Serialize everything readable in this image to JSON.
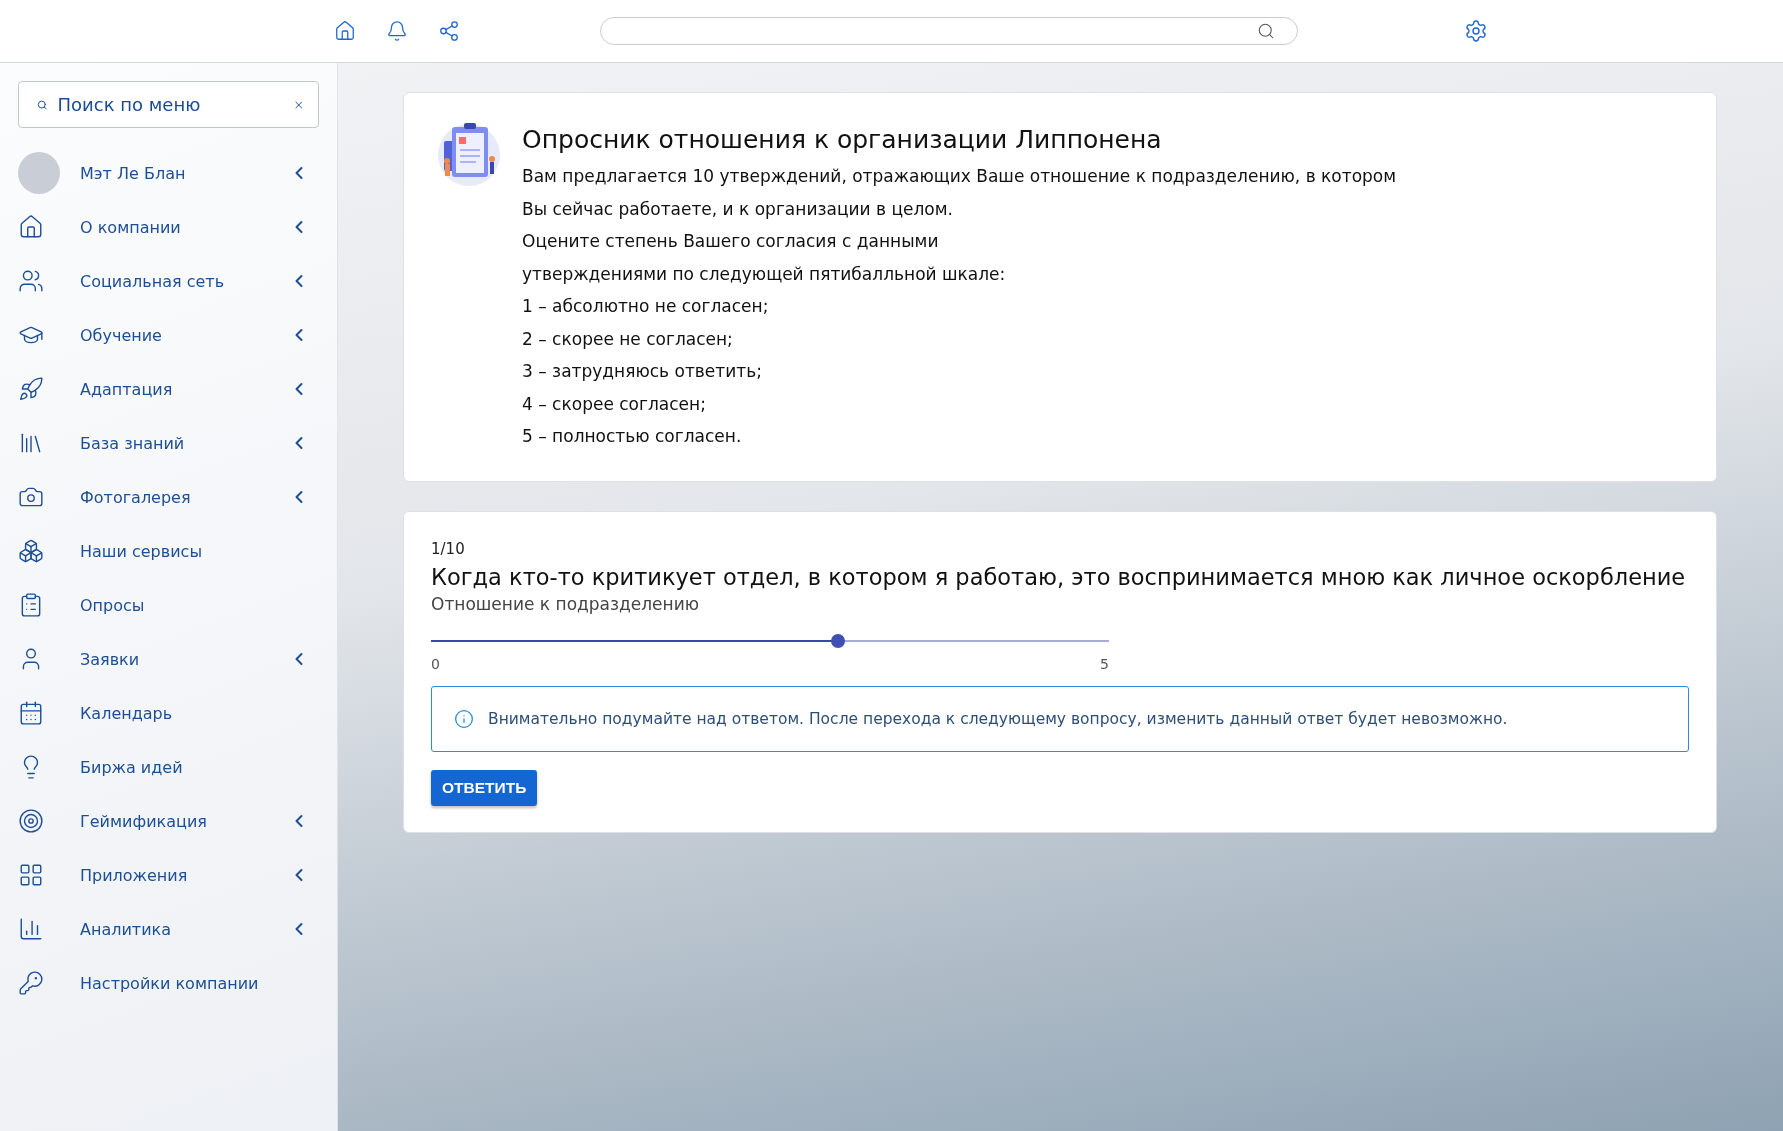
{
  "sidebar": {
    "search": {
      "placeholder": "Поиск по меню"
    },
    "items": [
      {
        "label": "Мэт Ле Блан",
        "kind": "profile",
        "has_submenu": true
      },
      {
        "label": "О компании",
        "kind": "link",
        "has_submenu": true
      },
      {
        "label": "Социальная сеть",
        "kind": "link",
        "has_submenu": true
      },
      {
        "label": "Обучение",
        "kind": "link",
        "has_submenu": true
      },
      {
        "label": "Адаптация",
        "kind": "link",
        "has_submenu": true
      },
      {
        "label": "База знаний",
        "kind": "link",
        "has_submenu": true
      },
      {
        "label": "Фотогалерея",
        "kind": "link",
        "has_submenu": true
      },
      {
        "label": "Наши сервисы",
        "kind": "link",
        "has_submenu": false
      },
      {
        "label": "Опросы",
        "kind": "link",
        "has_submenu": false
      },
      {
        "label": "Заявки",
        "kind": "link",
        "has_submenu": true
      },
      {
        "label": "Календарь",
        "kind": "link",
        "has_submenu": false
      },
      {
        "label": "Биржа идей",
        "kind": "link",
        "has_submenu": false
      },
      {
        "label": "Геймификация",
        "kind": "link",
        "has_submenu": true
      },
      {
        "label": "Приложения",
        "kind": "link",
        "has_submenu": true
      },
      {
        "label": "Аналитика",
        "kind": "link",
        "has_submenu": true
      },
      {
        "label": "Настройки компании",
        "kind": "link",
        "has_submenu": false
      }
    ]
  },
  "intro": {
    "title": "Опросник отношения к организации Липпонена",
    "lines": [
      "Вам предлагается 10 утверждений, отражающих Ваше отношение к подразделению, в котором",
      "Вы сейчас работаете, и к организации в целом.",
      "Оцените степень Вашего согласия с данными",
      "утверждениями по следующей пятибалльной шкале:",
      "1 – абсолютно не согласен;",
      "2 – скорее не согласен;",
      "3 – затрудняюсь ответить;",
      "4 – скорее согласен;",
      "5 – полностью согласен."
    ]
  },
  "question": {
    "counter": "1/10",
    "text": "Когда кто-то критикует отдел, в котором я работаю, это воспринимается мною как личное оскорбление",
    "category": "Отношение к подразделению",
    "slider": {
      "level": 0.6,
      "min_label": "0",
      "max_label": "5"
    },
    "notice": "Внимательно подумайте над ответом. После перехода к следующему вопросу, изменить данный ответ будет невозможно.",
    "button": "ОТВЕТИТЬ"
  }
}
